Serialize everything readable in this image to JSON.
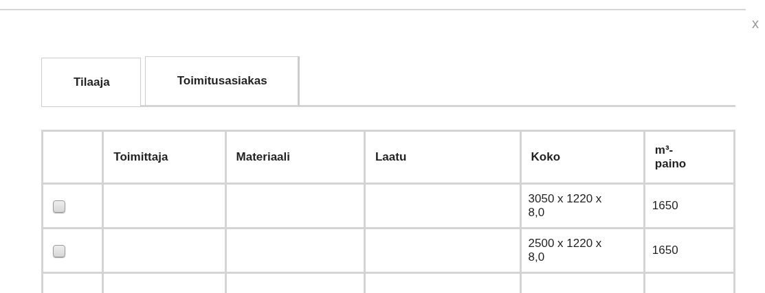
{
  "close_label": "x",
  "tabs": [
    {
      "label": "Tilaaja",
      "selected": false
    },
    {
      "label": "Toimitusasiakas",
      "selected": true
    }
  ],
  "table": {
    "columns": [
      "",
      "Toimittaja",
      "Materiaali",
      "Laatu",
      "Koko",
      "m³-paino"
    ],
    "rows": [
      {
        "checked": false,
        "cells": [
          "",
          "",
          "",
          "",
          "3050 x 1220 x 8,0",
          "1650"
        ]
      },
      {
        "checked": false,
        "cells": [
          "",
          "",
          "",
          "",
          "2500 x 1220 x 8,0",
          "1650"
        ]
      },
      {
        "cells": [
          "",
          "",
          "",
          "",
          "",
          ""
        ]
      }
    ]
  }
}
